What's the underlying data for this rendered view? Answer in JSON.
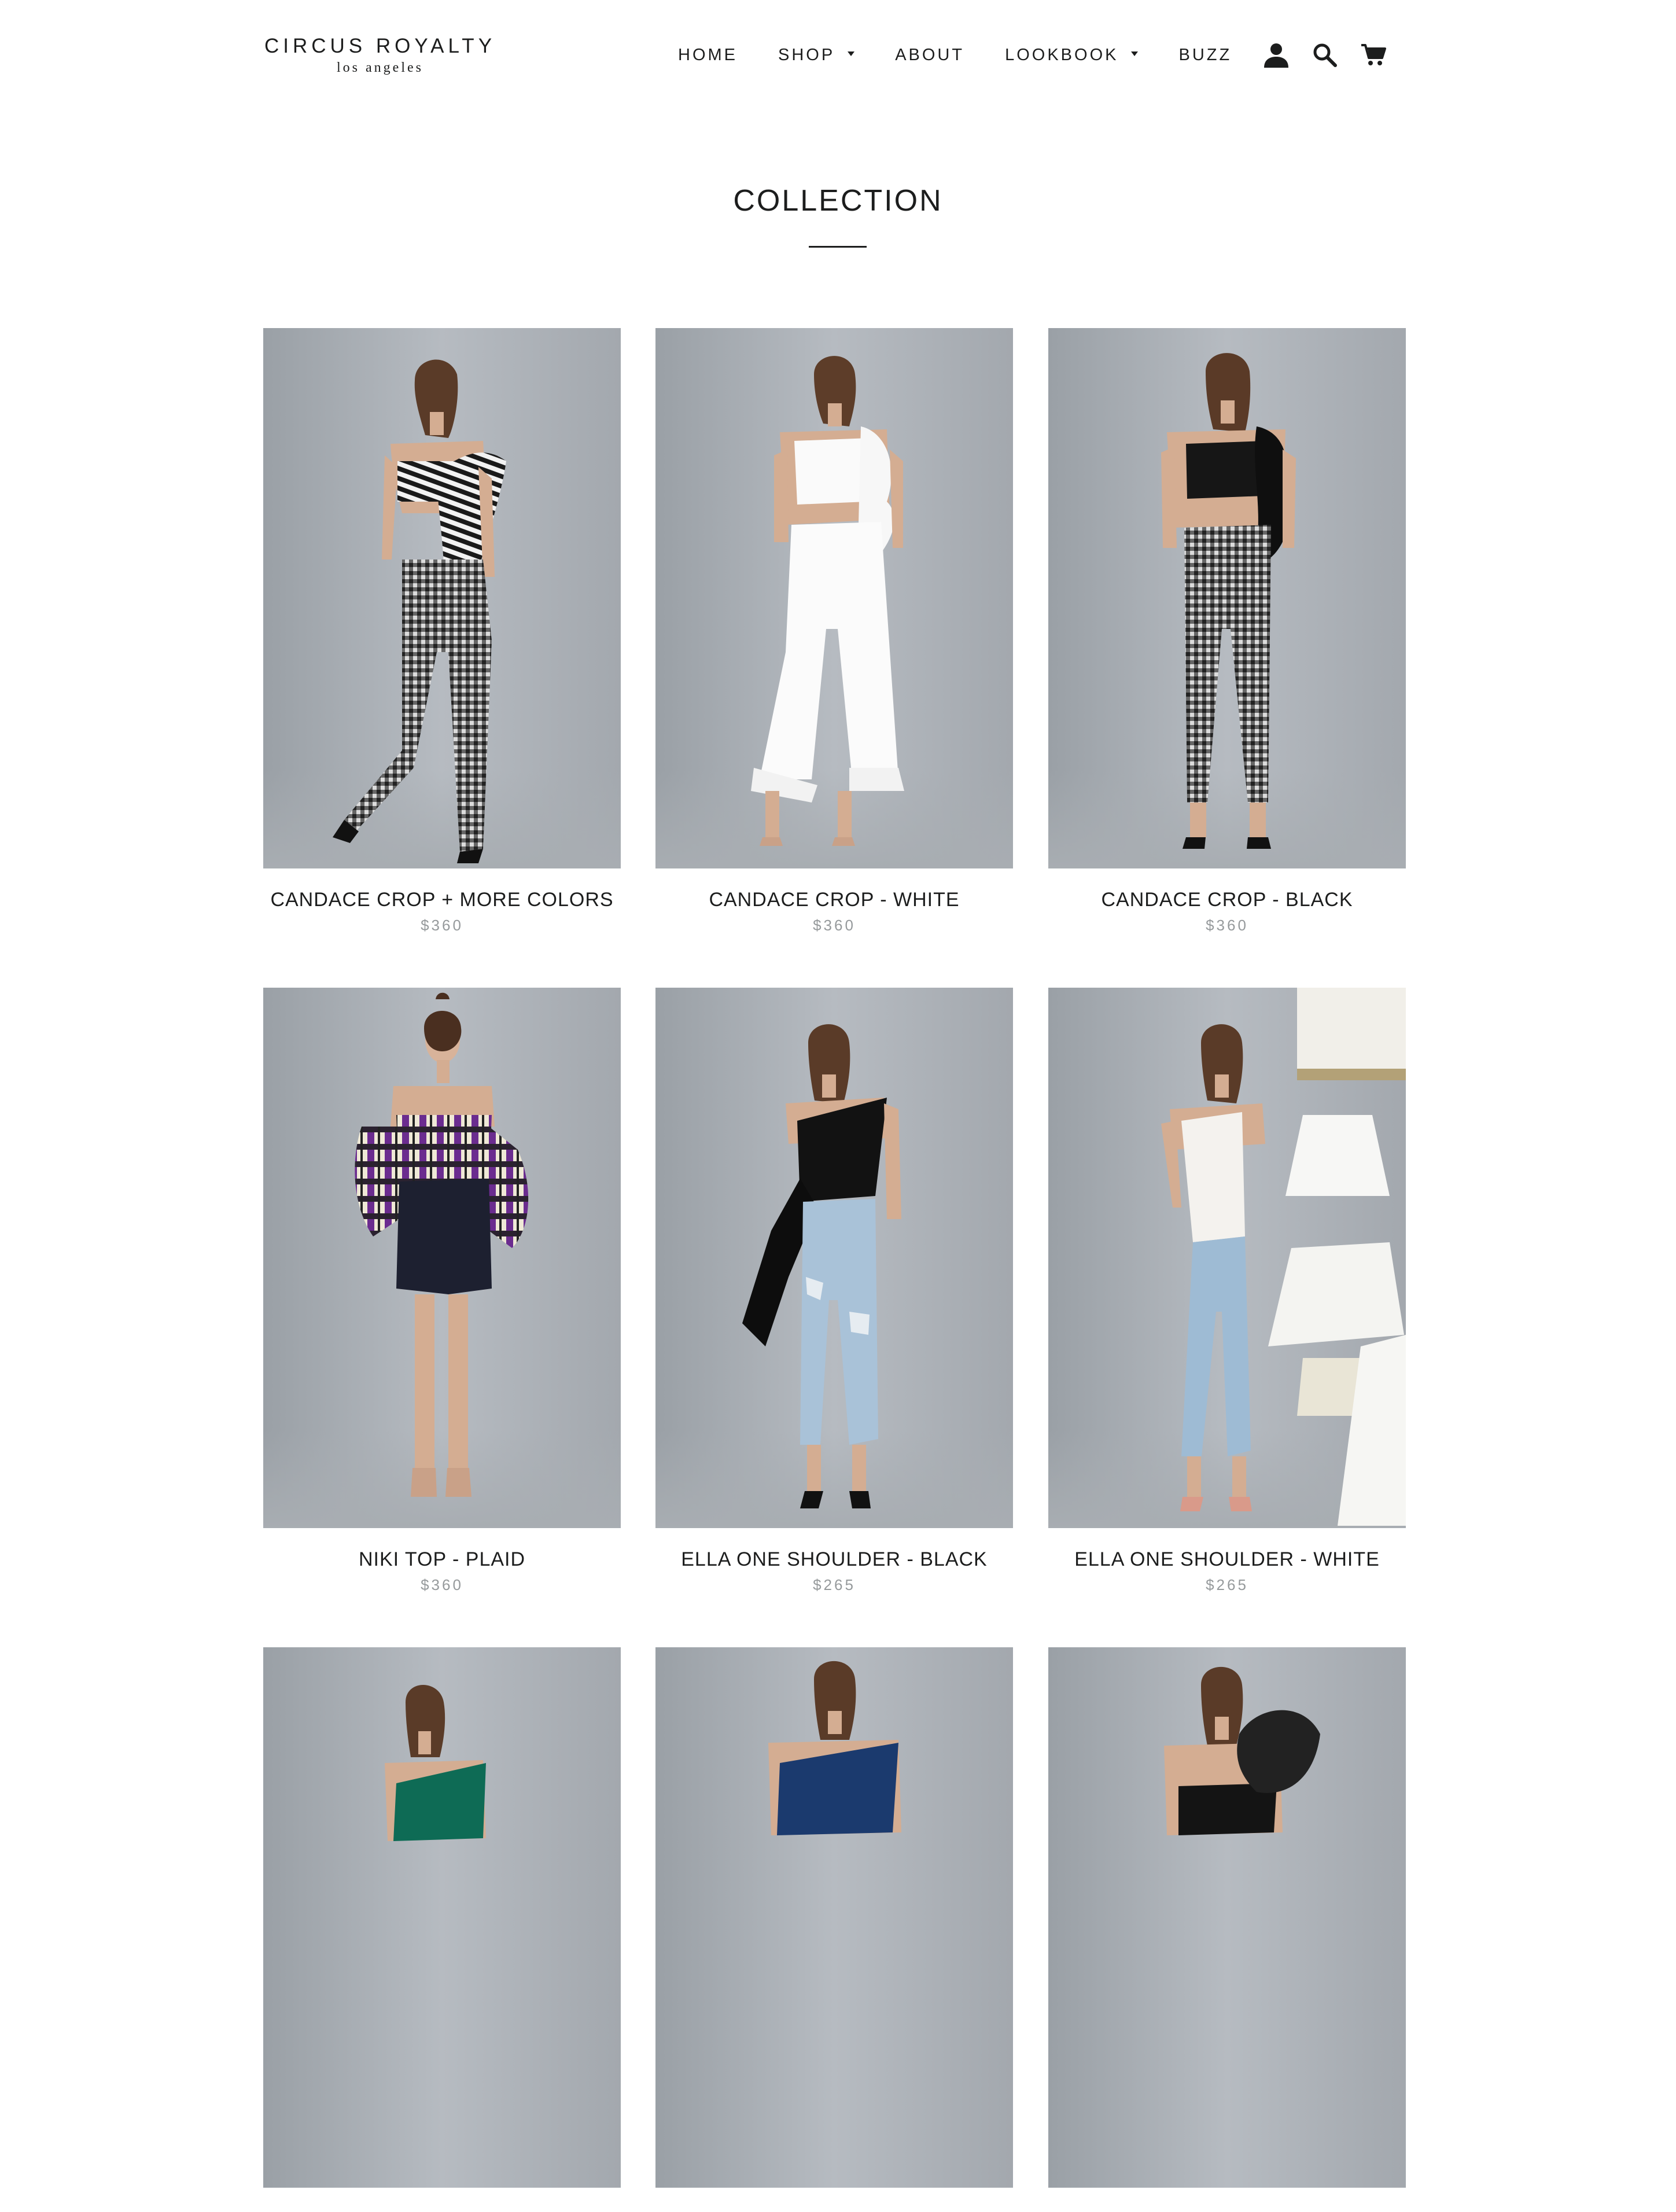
{
  "brand": {
    "name": "CIRCUS ROYALTY",
    "tagline": "los angeles"
  },
  "nav": {
    "items": [
      {
        "label": "HOME",
        "has_dropdown": false
      },
      {
        "label": "SHOP",
        "has_dropdown": true
      },
      {
        "label": "ABOUT",
        "has_dropdown": false
      },
      {
        "label": "LOOKBOOK",
        "has_dropdown": true
      },
      {
        "label": "BUZZ",
        "has_dropdown": false
      }
    ],
    "icons": [
      "account-icon",
      "search-icon",
      "cart-icon"
    ]
  },
  "page": {
    "title": "COLLECTION"
  },
  "colors": {
    "text": "#1c1d1d",
    "price": "#969a9c",
    "photo_background": "#a9aeb3"
  },
  "products": [
    {
      "name": "CANDACE CROP + MORE COLORS",
      "price": "$360"
    },
    {
      "name": "CANDACE CROP - WHITE",
      "price": "$360"
    },
    {
      "name": "CANDACE CROP - BLACK",
      "price": "$360"
    },
    {
      "name": "NIKI TOP - PLAID",
      "price": "$360"
    },
    {
      "name": "ELLA ONE SHOULDER - BLACK",
      "price": "$265"
    },
    {
      "name": "ELLA ONE SHOULDER - WHITE",
      "price": "$265"
    },
    {
      "name": "",
      "price": ""
    },
    {
      "name": "",
      "price": ""
    },
    {
      "name": "",
      "price": ""
    }
  ]
}
